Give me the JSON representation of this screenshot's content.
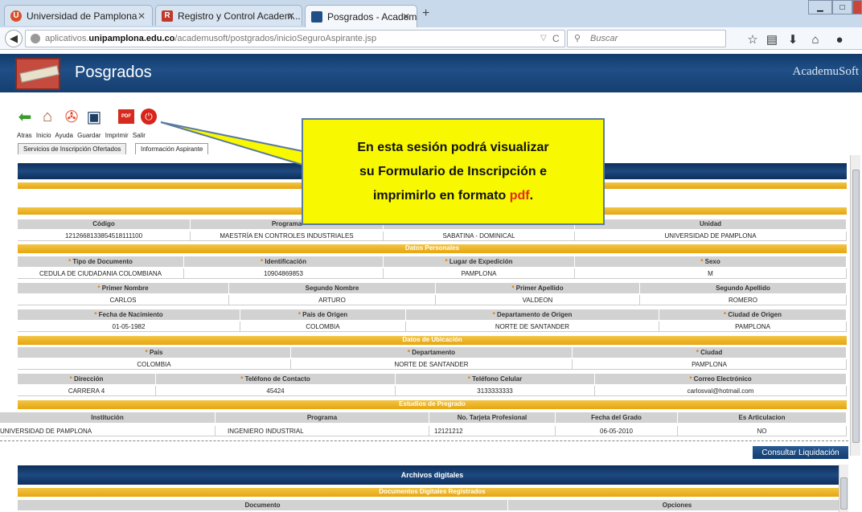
{
  "browser": {
    "tabs": [
      {
        "label": "Universidad de Pamplona",
        "favicon": "U",
        "favicon_color": "#c0392b"
      },
      {
        "label": "Registro y Control Academ...",
        "favicon": "R",
        "favicon_color": "#c0392b"
      },
      {
        "label": "Posgrados - AcademuSoft",
        "favicon": "",
        "favicon_color": "#1f4f86"
      }
    ],
    "url_prefix": "aplicativos.",
    "url_domain": "unipamplona.edu.co",
    "url_path": "/academusoft/postgrados/inicioSeguroAspirante.jsp",
    "search_placeholder": "Buscar"
  },
  "app": {
    "title": "Posgrados",
    "brand": "AcademuSoft"
  },
  "toolbar": {
    "labels": [
      "Atras",
      "Inicio",
      "Ayuda",
      "Guardar",
      "Imprimir",
      "Salir"
    ]
  },
  "page_tabs": [
    "Servicios de Inscripción Ofertados",
    "Información Aspirante"
  ],
  "callout": {
    "line1": "En esta sesión podrá visualizar",
    "line2": "su Formulario de Inscripción e",
    "line3_pre": "imprimirlo en formato ",
    "line3_pdf": "pdf",
    "line3_post": "."
  },
  "programa": {
    "headers": [
      "Código",
      "Programa",
      "",
      "Unidad"
    ],
    "values": [
      "12126681338545181111​00",
      "MAESTRÍA EN CONTROLES INDUSTRIALES",
      "SABATINA - DOMINICAL",
      "UNIVERSIDAD DE PAMPLONA"
    ]
  },
  "datos_personales": {
    "title": "Datos Personales",
    "row1_headers": [
      "Tipo de Documento",
      "Identificación",
      "Lugar de Expedición",
      "Sexo"
    ],
    "row1_values": [
      "CEDULA DE CIUDADANIA COLOMBIANA",
      "10904869853",
      "PAMPLONA",
      "M"
    ],
    "row2_headers": [
      "Primer Nombre",
      "Segundo Nombre",
      "Primer Apellido",
      "Segundo Apellido"
    ],
    "row2_values": [
      "CARLOS",
      "ARTURO",
      "VALDEON",
      "ROMERO"
    ],
    "row3_headers": [
      "Fecha de Nacimiento",
      "País de Origen",
      "Departamento de Origen",
      "Ciudad de Origen"
    ],
    "row3_values": [
      "01-05-1982",
      "COLOMBIA",
      "NORTE DE SANTANDER",
      "PAMPLONA"
    ]
  },
  "datos_ubicacion": {
    "title": "Datos de Ubicación",
    "row1_headers": [
      "País",
      "Departamento",
      "Ciudad"
    ],
    "row1_values": [
      "COLOMBIA",
      "NORTE DE SANTANDER",
      "PAMPLONA"
    ],
    "row2_headers": [
      "Dirección",
      "Teléfono de Contacto",
      "Teléfono Celular",
      "Correo Electrónico"
    ],
    "row2_values": [
      "CARRERA 4",
      "45424",
      "3133333333",
      "carlosval@hotmail.com"
    ]
  },
  "estudios": {
    "title": "Estudios de Pregrado",
    "headers": [
      "Institución",
      "Programa",
      "No. Tarjeta Profesional",
      "Fecha del Grado",
      "Es Articulacion"
    ],
    "values": [
      "UNIVERSIDAD DE PAMPLONA",
      "INGENIERO INDUSTRIAL",
      "12121212",
      "06-05-2010",
      "NO"
    ]
  },
  "consultar_label": "Consultar Liquidación",
  "archivos": {
    "title": "Archivos digitales",
    "subtitle": "Documentos Digitales Registrados",
    "headers": [
      "Documento",
      "Opciones"
    ]
  }
}
